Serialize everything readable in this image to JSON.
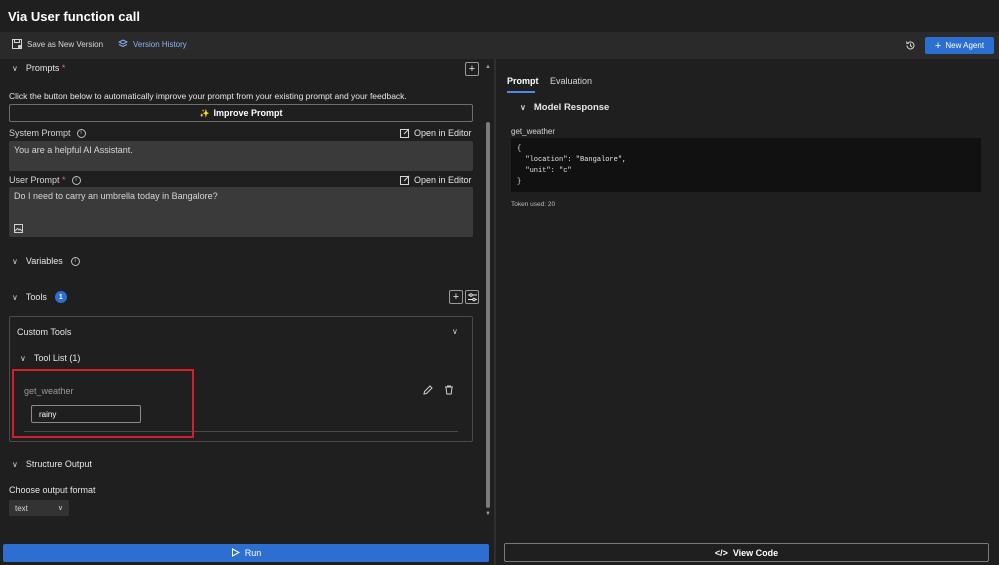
{
  "window": {
    "title": "Via User function call"
  },
  "toolbar": {
    "save_label": "Save as New Version",
    "history_label": "Version History",
    "new_agent_label": "New Agent"
  },
  "prompts": {
    "header": "Prompts",
    "required_mark": "*",
    "description": "Click the button below to automatically improve your prompt from your existing prompt and your feedback.",
    "improve_label": "Improve Prompt",
    "system_prompt_label": "System Prompt",
    "system_prompt_value": "You are a helpful AI Assistant.",
    "user_prompt_label": "User Prompt",
    "user_prompt_value": "Do I need to carry an umbrella today in Bangalore?",
    "open_editor_label": "Open in Editor"
  },
  "variables": {
    "header": "Variables"
  },
  "tools": {
    "header": "Tools",
    "count": "1",
    "custom_tools_label": "Custom Tools",
    "tool_list_label": "Tool List (1)",
    "tool_name": "get_weather",
    "tool_input_value": "rainy"
  },
  "structure_output": {
    "header": "Structure Output",
    "format_label": "Choose output format",
    "format_value": "text"
  },
  "run": {
    "label": "Run"
  },
  "right": {
    "tabs": [
      "Prompt",
      "Evaluation"
    ],
    "model_response_label": "Model Response",
    "function_name": "get_weather",
    "code": "{\n  \"location\": \"Bangalore\",\n  \"unit\": \"c\"\n}",
    "token_usage": "Token used: 20",
    "view_code_label": "View Code"
  },
  "colors": {
    "accent": "#2c6fd1",
    "highlight_border": "#d2202a",
    "background": "#1f1f1f"
  }
}
